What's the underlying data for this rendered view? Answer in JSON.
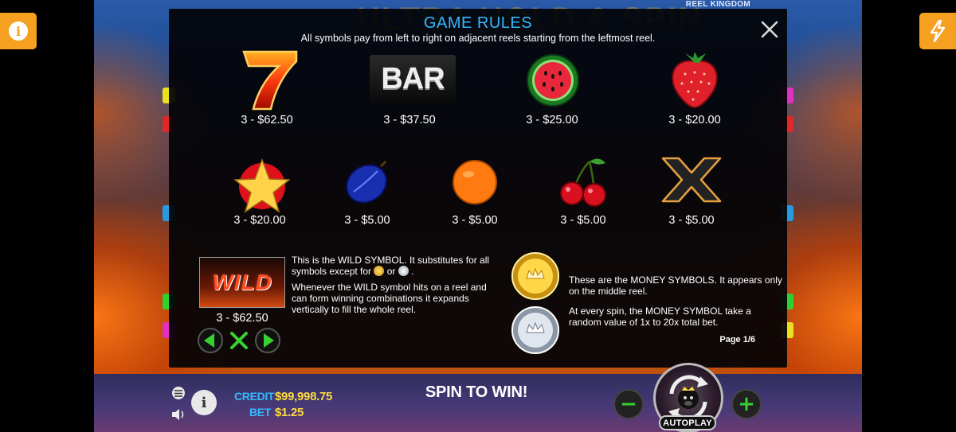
{
  "brand": "REEL KINGDOM",
  "background_title": "ULTRA HOLD & SPIN",
  "rules": {
    "title": "GAME RULES",
    "subtitle": "All symbols pay from left to right on adjacent reels starting from the leftmost reel.",
    "close_icon": "close-icon",
    "row1": [
      {
        "symbol": "seven",
        "pay": "3 - $62.50"
      },
      {
        "symbol": "bar",
        "label": "BAR",
        "pay": "3 - $37.50"
      },
      {
        "symbol": "watermelon",
        "pay": "3 - $25.00"
      },
      {
        "symbol": "strawberry",
        "pay": "3 - $20.00"
      }
    ],
    "row2": [
      {
        "symbol": "star",
        "pay": "3 - $20.00"
      },
      {
        "symbol": "plum",
        "pay": "3 - $5.00"
      },
      {
        "symbol": "orange",
        "pay": "3 - $5.00"
      },
      {
        "symbol": "cherries",
        "pay": "3 - $5.00"
      },
      {
        "symbol": "x",
        "pay": "3 - $5.00"
      }
    ],
    "wild": {
      "label": "WILD",
      "pay": "3 - $62.50",
      "desc1_a": "This is the WILD SYMBOL. It substitutes for all symbols except for",
      "desc1_or": "or",
      "desc1_end": ".",
      "desc2": "Whenever the WILD symbol hits on a reel and can form winning combinations it expands vertically to fill the whole reel."
    },
    "money": {
      "desc1": "These are the MONEY SYMBOLS. It appears only on the middle reel.",
      "desc2": "At every spin, the MONEY SYMBOL take a random value of 1x to 20x total bet."
    },
    "page": "Page 1/6"
  },
  "bottom": {
    "credit_label": "CREDIT",
    "credit_value": "$99,998.75",
    "bet_label": "BET",
    "bet_value": "$1.25",
    "spin_message": "SPIN TO WIN!",
    "autoplay_label": "AUTOPLAY",
    "minus_label": "−",
    "plus_label": "+",
    "info_label": "i"
  },
  "colors": {
    "accent_blue": "#36b8ff",
    "value_yellow": "#ffdc40",
    "side_orange": "#f5a020",
    "nav_green": "#37d030"
  }
}
